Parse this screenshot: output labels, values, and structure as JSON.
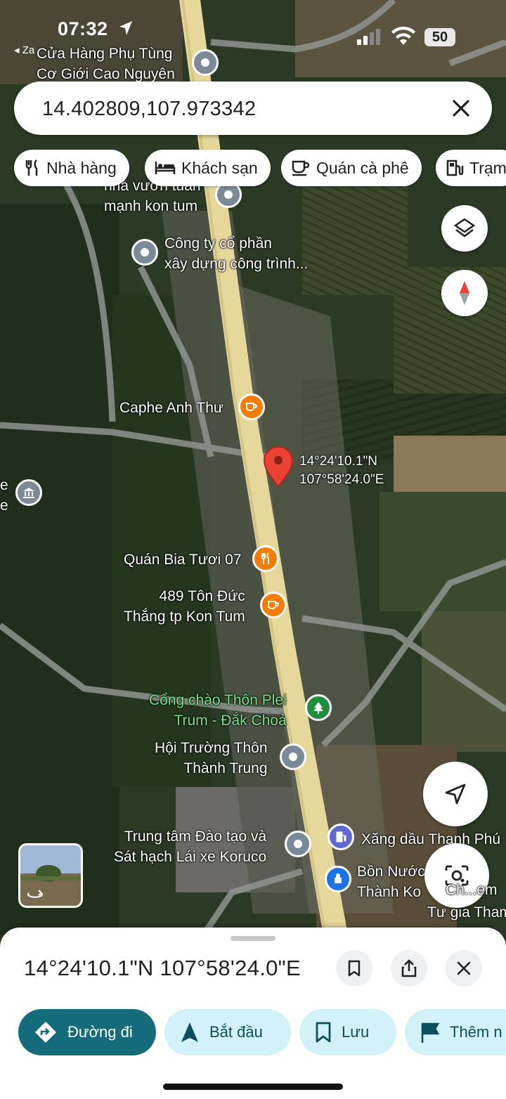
{
  "status_bar": {
    "time": "07:32",
    "back_app": "Za",
    "battery": "50"
  },
  "search": {
    "value": "14.402809,107.973342"
  },
  "chips": [
    {
      "label": "Nhà hàng",
      "icon": "restaurant-icon"
    },
    {
      "label": "Khách sạn",
      "icon": "hotel-icon"
    },
    {
      "label": "Quán cà phê",
      "icon": "coffee-icon"
    },
    {
      "label": "Trạm",
      "icon": "gas-station-icon"
    }
  ],
  "map": {
    "places": [
      {
        "label": "Cửa Hàng Phụ Tùng\nCơ Giới Cao Nguyên",
        "icon": "place-pin-icon"
      },
      {
        "label": "nhà vườn tuấn\nmạnh kon tum",
        "icon": "place-pin-icon"
      },
      {
        "label": "Công ty cổ phần\nxây dựng công trình...",
        "icon": "place-pin-icon"
      },
      {
        "label": "Caphe Anh Thư",
        "icon": "cafe-pin-icon"
      },
      {
        "label": "Quán Bia Tươi 07",
        "icon": "restaurant-pin-icon"
      },
      {
        "label": "489 Tôn Đức\nThắng tp Kon Tum",
        "icon": "cafe-pin-icon"
      },
      {
        "label": "Cổng chào Thôn Plei\nTrum - Đắk Choả",
        "icon": "park-pin-icon"
      },
      {
        "label": "Hội Trường Thôn\nThành Trung",
        "icon": "place-pin-icon"
      },
      {
        "label": "Trung tâm Đào tạo và\nSát hạch Lái xe Koruco",
        "icon": "place-pin-icon"
      },
      {
        "label": "Xăng dầu Thanh Phú",
        "icon": "gas-pin-icon"
      },
      {
        "label": "Bồn Nước\nThành Ko",
        "icon": "water-pin-icon"
      },
      {
        "label": "Ch...em",
        "icon": ""
      },
      {
        "label": "Tư gia Tham",
        "icon": ""
      },
      {
        "label": "e\ne",
        "icon": "museum-pin-icon"
      }
    ],
    "dropped_pin": {
      "coords": "14°24'10.1\"N\n107°58'24.0\"E"
    }
  },
  "sheet": {
    "title": "14°24'10.1\"N 107°58'24.0\"E",
    "actions": [
      {
        "label": "Đường đi",
        "primary": true
      },
      {
        "label": "Bắt đầu"
      },
      {
        "label": "Lưu"
      },
      {
        "label": "Thêm n"
      }
    ]
  },
  "colors": {
    "primary": "#146c7a",
    "tonal": "#d3f1f8",
    "pin_red": "#ea4335",
    "orange": "#f57c00",
    "gray_pin": "#7a8a98",
    "green_pin": "#1e8e3e",
    "blue_pin": "#4285f4"
  }
}
